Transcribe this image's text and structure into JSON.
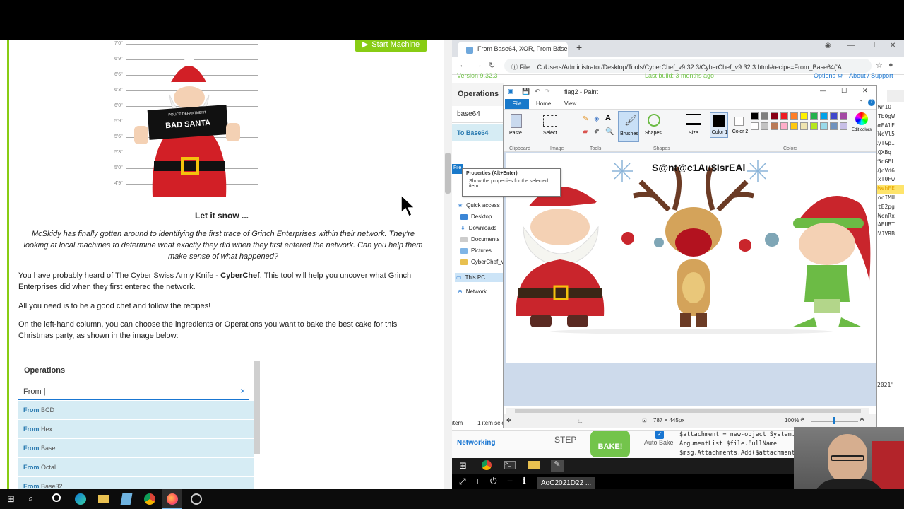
{
  "article": {
    "start_machine": "Start Machine",
    "mug_sign": "BAD SANTA",
    "mug_dept": "POLICE DEPARTMENT",
    "heights": [
      "7'0\"",
      "6'9\"",
      "6'6\"",
      "6'3\"",
      "6'0\"",
      "5'9\"",
      "5'6\"",
      "5'3\"",
      "5'0\"",
      "4'9\""
    ],
    "caption": "Let it snow ...",
    "intro": "McSkidy has finally gotten around to identifying the first trace of Grinch Enterprises within their network. They're looking at local machines to determine what exactly they did when they first entered the network. Can you help them make sense of what happened?",
    "p1_a": "You have probably heard of The Cyber Swiss Army Knife - ",
    "p1_b": "CyberChef",
    "p1_c": ". This tool will help you uncover what Grinch Enterprises did when they first entered the network.",
    "p2": "All you need is to be a good chef and follow the recipes!",
    "p3": "On the left-hand column, you can choose the ingredients or Operations you want to bake the best cake for this Christmas party, as shown in the image below:",
    "ops_title": "Operations",
    "ops_search": "From |",
    "ops_close": "×",
    "ops_items": [
      {
        "prefix": "From",
        "rest": " BCD"
      },
      {
        "prefix": "From",
        "rest": " Hex"
      },
      {
        "prefix": "From",
        "rest": " Base"
      },
      {
        "prefix": "From",
        "rest": " Octal"
      },
      {
        "prefix": "From",
        "rest": " Base32"
      }
    ]
  },
  "browser": {
    "tab_title": "From Base64, XOR, From Base64",
    "tab_close": "×",
    "new_tab": "+",
    "url_scheme": "File",
    "url": "C:/Users/Administrator/Desktop/Tools/CyberChef_v9.32.3/CyberChef_v9.32.3.html#recipe=From_Base64('A..."
  },
  "cyberchef": {
    "version": "Version 9.32.3",
    "last_build": "Last build: 3 months ago",
    "options": "Options",
    "about": "About / Support",
    "ops_header": "Operations",
    "search": "base64",
    "op_to_base64": "To Base64",
    "output_lines": [
      "tWn1O",
      "JTb0gW",
      "6mEAlE",
      "FNcVl5",
      "RyTGpI",
      "1QXBq",
      "P5cGFL",
      "4QcVd6",
      "txT0Fw",
      "9WehFE",
      "locIMU",
      "ttE2pg",
      "5WcnRx",
      "dAEUBT",
      "dVJVRB"
    ],
    "output_end": "2021\"",
    "networking": "Networking",
    "step": "STEP",
    "bake": "BAKE!",
    "auto_bake": "Auto Bake",
    "recipe_lines": [
      "$attachment = new-object System.",
      "ArgumentList $file.FullName",
      "$msg.Attachments.Add($attachment"
    ]
  },
  "paint": {
    "title": "flag2 - Paint",
    "file_tab": "File",
    "home_tab": "Home",
    "view_tab": "View",
    "paste": "Paste",
    "select": "Select",
    "brushes": "Brushes",
    "shapes": "Shapes",
    "size": "Size",
    "color1": "Color 1",
    "color2": "Color 2",
    "edit_colors": "Edit colors",
    "groups": {
      "clipboard": "Clipboard",
      "image": "Image",
      "tools": "Tools",
      "shapes": "Shapes",
      "colors": "Colors"
    },
    "flag_text": "S@nt@c1Au$IsrEAl",
    "dimensions": "787 × 445px",
    "zoom": "100%",
    "palette": [
      "#000000",
      "#7f7f7f",
      "#880015",
      "#ed1c24",
      "#ff7f27",
      "#fff200",
      "#22b14c",
      "#00a2e8",
      "#3f48cc",
      "#a349a4",
      "#ffffff",
      "#c3c3c3",
      "#b97a57",
      "#ffaec9",
      "#ffc90e",
      "#efe4b0",
      "#b5e61d",
      "#99d9ea",
      "#7092be",
      "#c8bfe7"
    ]
  },
  "explorer": {
    "quick_access": "Quick access",
    "desktop": "Desktop",
    "downloads": "Downloads",
    "documents": "Documents",
    "pictures": "Pictures",
    "cyberchef_folder": "CyberChef_v9",
    "this_pc": "This PC",
    "network": "Network",
    "items": "item",
    "selected": "1 item sele",
    "file_btn": "File"
  },
  "tooltip": {
    "title": "Properties (Alt+Enter)",
    "body": "Show the properties for the selected item."
  },
  "remote": {
    "session": "AoC2021D22 ..."
  }
}
